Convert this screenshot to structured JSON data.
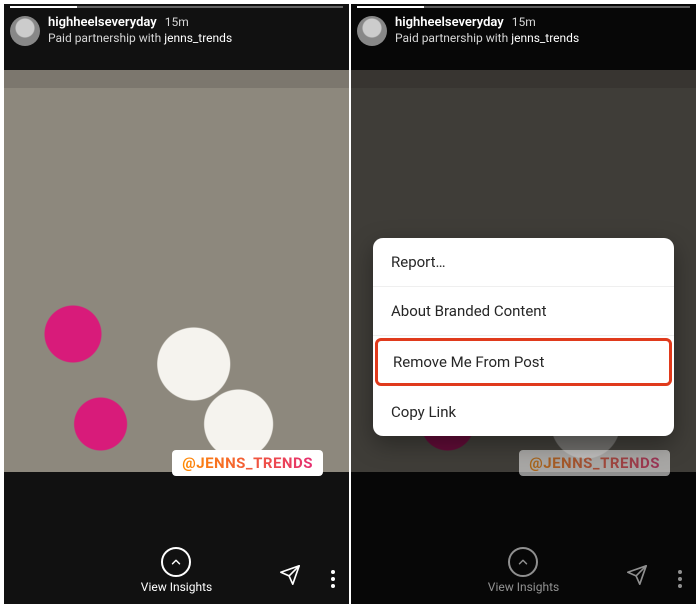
{
  "story": {
    "username": "highheelseveryday",
    "timestamp": "15m",
    "partnership_prefix": "Paid partnership with",
    "partnership_brand": "jenns_trends",
    "mention_sticker": "@JENNS_TRENDS",
    "view_insights_label": "View Insights"
  },
  "menu": {
    "items": [
      "Report…",
      "About Branded Content",
      "Remove Me From Post",
      "Copy Link"
    ]
  }
}
